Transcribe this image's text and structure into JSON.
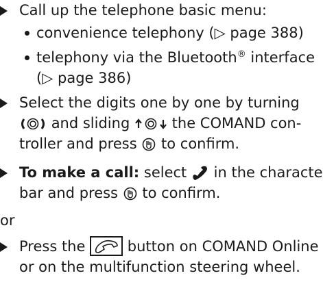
{
  "step1": {
    "text": "Call up the telephone basic menu:",
    "bullets": [
      {
        "text": "convenience telephony (▷ page 388)"
      },
      {
        "line1": "telephony via the Bluetooth",
        "sup": "®",
        "line1_end": " interface",
        "line2": "(▷ page 386)"
      }
    ]
  },
  "step2": {
    "line1_a": "Select the digits one by one by turning",
    "line2_a": "and sliding",
    "line2_b": "the COMAND con-",
    "line3_a": "troller and press",
    "line3_b": "to confirm."
  },
  "step3": {
    "bold": "To make a call:",
    "line1_a": "select",
    "line1_b": "in the character",
    "line2_a": "bar and press",
    "line2_b": "to confirm."
  },
  "or_text": "or",
  "step4": {
    "line1_a": "Press the",
    "line1_b": "button on COMAND Online",
    "line2": "or on the multifunction steering wheel."
  },
  "icons": {
    "step_marker": "triangle-icon",
    "turn_controller": "turn-controller-icon",
    "slide_controller": "slide-controller-icon",
    "press_controller": "press-controller-icon",
    "phone": "phone-icon",
    "phone_button": "phone-button-icon"
  },
  "colors": {
    "text": "#1a1a1a"
  }
}
